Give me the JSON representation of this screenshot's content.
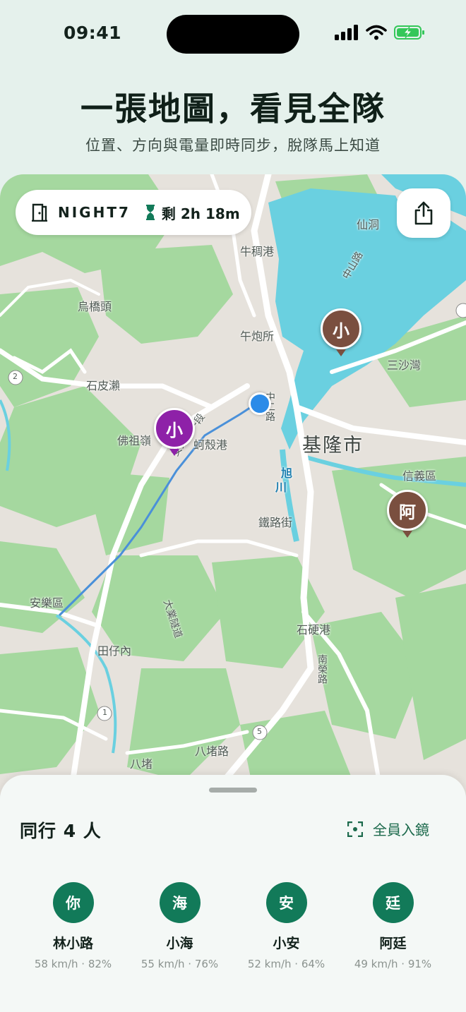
{
  "status_bar": {
    "time": "09:41"
  },
  "hero": {
    "title": "一張地圖，看見全隊",
    "subtitle": "位置、方向與電量即時同步，脫隊馬上知道"
  },
  "trip": {
    "code": "NIGHT7",
    "remaining": "剩 2h 18m",
    "door_icon": "door-icon",
    "hourglass_icon": "hourglass-icon",
    "share_icon": "share-icon"
  },
  "map": {
    "labels": [
      "牛稠港",
      "仙洞",
      "烏橋頭",
      "午炮所",
      "三沙灣",
      "石皮瀨",
      "佛祖嶺",
      "蚵殼港",
      "基隆市",
      "信義區",
      "旭",
      "川",
      "鐵路街",
      "安樂區",
      "田仔內",
      "石硬港",
      "八堵",
      "八堵路",
      "中二路",
      "安樂路一段",
      "大業隧道",
      "南榮路",
      "中山路",
      "2",
      "1",
      "5"
    ],
    "pins": [
      {
        "initial": "小",
        "color": "#7a4f3f"
      },
      {
        "initial": "小",
        "color": "#8e21a8"
      },
      {
        "initial": "阿",
        "color": "#7a4f3f"
      }
    ],
    "water_color": "#6ad0e0",
    "green_color": "#9fd69a",
    "route_color": "#4a90d9"
  },
  "sheet": {
    "title": "同行 4 人",
    "fit_label": "全員入鏡",
    "fit_icon": "focus-frame-icon"
  },
  "members": [
    {
      "initial": "你",
      "name": "林小路",
      "stat": "58 km/h · 82%"
    },
    {
      "initial": "海",
      "name": "小海",
      "stat": "55 km/h · 76%"
    },
    {
      "initial": "安",
      "name": "小安",
      "stat": "52 km/h · 64%"
    },
    {
      "initial": "廷",
      "name": "阿廷",
      "stat": "49 km/h · 91%"
    }
  ]
}
